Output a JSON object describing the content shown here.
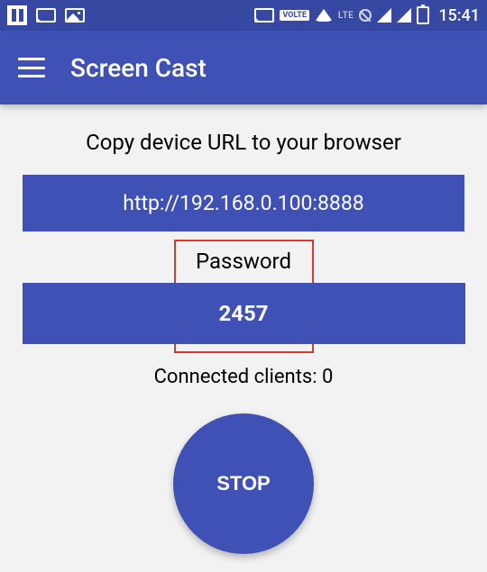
{
  "status": {
    "battery": "89",
    "clock": "15:41",
    "volte": "VOLTE",
    "lte": "LTE"
  },
  "appbar": {
    "title": "Screen Cast"
  },
  "main": {
    "instruction": "Copy device URL to your browser",
    "url": "http://192.168.0.100:8888",
    "password_label": "Password",
    "password_value": "2457",
    "clients_label": "Connected clients: 0",
    "stop_label": "STOP"
  },
  "colors": {
    "primary": "#3f51b5",
    "status_bg": "#3648a2",
    "highlight": "#d33b2a"
  }
}
